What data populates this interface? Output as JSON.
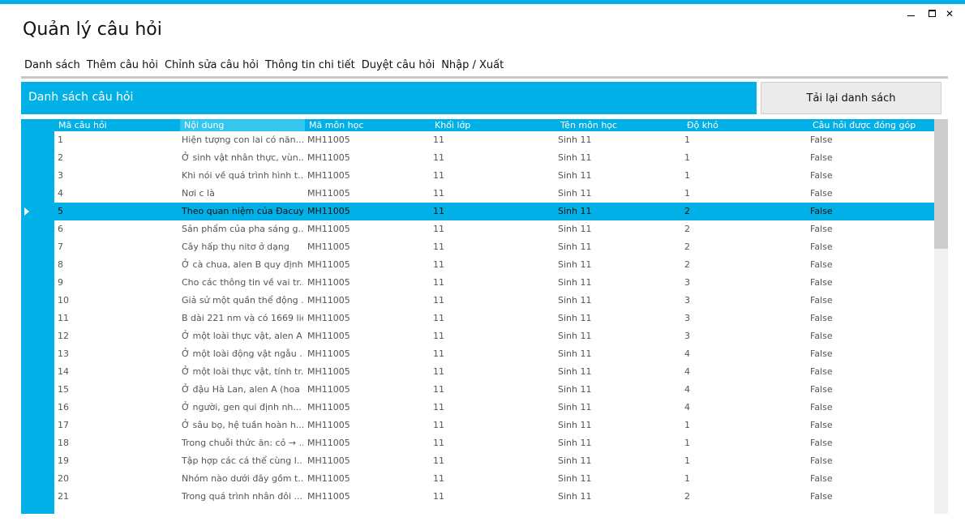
{
  "window": {
    "title": "Quản lý câu hỏi",
    "controls": {
      "minimize": "minimize",
      "maximize": "maximize",
      "close": "✕"
    }
  },
  "tabs": [
    {
      "label": "Danh sách"
    },
    {
      "label": "Thêm câu hỏi"
    },
    {
      "label": "Chỉnh sửa câu hỏi"
    },
    {
      "label": "Thông tin chi tiết"
    },
    {
      "label": "Duyệt câu hỏi"
    },
    {
      "label": "Nhập / Xuất"
    }
  ],
  "banner": {
    "label": "Danh sách câu hỏi"
  },
  "reload_button": {
    "label": "Tải lại danh sách"
  },
  "table": {
    "columns": [
      "Mã câu hỏi",
      "Nội dung",
      "Mã môn học",
      "Khối lớp",
      "Tên môn học",
      "Độ khó",
      "Câu hỏi được đóng góp"
    ],
    "sorted_column": "Nội dung",
    "selected_row": 4,
    "rows": [
      [
        "1",
        "Hiện tượng con lai có năn...",
        "MH11005",
        "11",
        "Sinh 11",
        "1",
        "False"
      ],
      [
        "2",
        "Ở sinh vật nhân thực, vùn...",
        "MH11005",
        "11",
        "Sinh 11",
        "1",
        "False"
      ],
      [
        "3",
        "Khi nói về quá trình hình t...",
        "MH11005",
        "11",
        "Sinh 11",
        "1",
        "False"
      ],
      [
        "4",
        "Nơi c là",
        "MH11005",
        "11",
        "Sinh 11",
        "1",
        "False"
      ],
      [
        "5",
        "Theo quan niệm của Đacuy...",
        "MH11005",
        "11",
        "Sinh 11",
        "2",
        "False"
      ],
      [
        "6",
        "Sản phẩm của pha sáng g...",
        "MH11005",
        "11",
        "Sinh 11",
        "2",
        "False"
      ],
      [
        "7",
        "Cây hấp thụ nitơ ở dạng",
        "MH11005",
        "11",
        "Sinh 11",
        "2",
        "False"
      ],
      [
        "8",
        "Ở cà chua, alen B quy định...",
        "MH11005",
        "11",
        "Sinh 11",
        "2",
        "False"
      ],
      [
        "9",
        "Cho các thông tin về vai tr...",
        "MH11005",
        "11",
        "Sinh 11",
        "3",
        "False"
      ],
      [
        "10",
        "Giả sử một quần thể động ...",
        "MH11005",
        "11",
        "Sinh 11",
        "3",
        "False"
      ],
      [
        "11",
        "B dài 221 nm và có 1669 liê...",
        "MH11005",
        "11",
        "Sinh 11",
        "3",
        "False"
      ],
      [
        "12",
        "Ở một loài thực vật, alen A ...",
        "MH11005",
        "11",
        "Sinh 11",
        "3",
        "False"
      ],
      [
        "13",
        "Ở một loài động vật ngẫu ...",
        "MH11005",
        "11",
        "Sinh 11",
        "4",
        "False"
      ],
      [
        "14",
        "Ở một loài thực vật, tính tr...",
        "MH11005",
        "11",
        "Sinh 11",
        "4",
        "False"
      ],
      [
        "15",
        "Ở đậu Hà Lan, alen A (hoa ...",
        "MH11005",
        "11",
        "Sinh 11",
        "4",
        "False"
      ],
      [
        "16",
        "Ở người, gen qui định nh...",
        "MH11005",
        "11",
        "Sinh 11",
        "4",
        "False"
      ],
      [
        "17",
        " Ở sâu bọ, hệ tuần hoàn h...",
        "MH11005",
        "11",
        "Sinh 11",
        "1",
        "False"
      ],
      [
        "18",
        "Trong chuỗi thức ăn: cỏ → ...",
        "MH11005",
        "11",
        "Sinh 11",
        "1",
        "False"
      ],
      [
        "19",
        "Tập hợp các cá thể  cùng l...",
        "MH11005",
        "11",
        "Sinh 11",
        "1",
        "False"
      ],
      [
        "20",
        "Nhóm nào dưới đây gồm t...",
        "MH11005",
        "11",
        "Sinh 11",
        "1",
        "False"
      ],
      [
        "21",
        "Trong quá trình nhân đôi ...",
        "MH11005",
        "11",
        "Sinh 11",
        "2",
        "False"
      ]
    ]
  },
  "colors": {
    "accent": "#00b0e6",
    "sorted_header": "#33c6ef",
    "button_bg": "#ebebeb"
  }
}
